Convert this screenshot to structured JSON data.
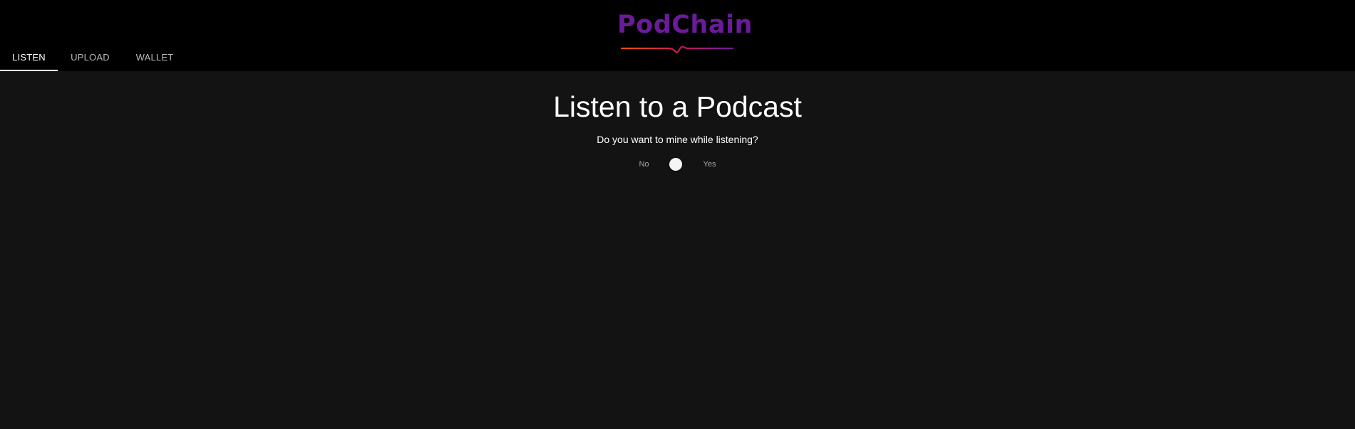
{
  "app": {
    "logo_text": "PodChain"
  },
  "nav": {
    "tabs": [
      {
        "label": "LISTEN",
        "active": true
      },
      {
        "label": "UPLOAD",
        "active": false
      },
      {
        "label": "WALLET",
        "active": false
      }
    ]
  },
  "main": {
    "title": "Listen to a Podcast",
    "question": "Do you want to mine while listening?",
    "mine_toggle": {
      "off_label": "No",
      "on_label": "Yes",
      "checked": false
    }
  },
  "colors": {
    "app_bar": "#000000",
    "page_background": "#131313",
    "logo_purple": "#6a1b9a",
    "logo_wave_orange": "#e65100",
    "logo_wave_purple": "#6a1b9a"
  }
}
